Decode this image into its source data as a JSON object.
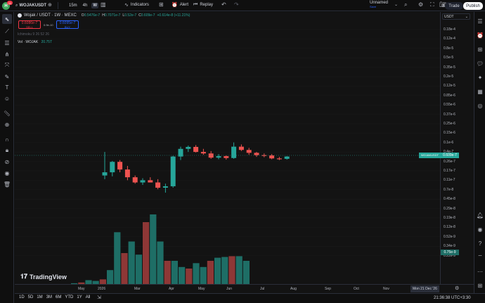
{
  "topbar": {
    "avatar_letter": "H",
    "notif_count": "11",
    "symbol": "WOJAKUSDT",
    "intervals": [
      "15m",
      "4h",
      "W"
    ],
    "active_interval": "W",
    "indicators_label": "Indicators",
    "alert_label": "Alert",
    "replay_label": "Replay",
    "layout_name": "Unnamed",
    "layout_status": "Save",
    "trade_label": "Trade",
    "publish_label": "Publish"
  },
  "legend": {
    "title": "Wojak / USDT · 1W · MEXC",
    "o_label": "O",
    "o_value": "0.5476e-7",
    "h_label": "H",
    "h_value": "0.7071e-7",
    "l_label": "L",
    "l_value": "0.52e-7",
    "c_label": "C",
    "c_value": "0.609e-7",
    "change": "+0.614e-8 (+11.21%)",
    "sell_price": "0.6086e-7",
    "sell_label": "SELL",
    "spread": "0.9e-10",
    "buy_price": "0.6095e-7",
    "buy_label": "BUY",
    "ichimoku": "Ichimoku 9 26 52 26",
    "vol_label": "Vol · WOJAK",
    "vol_value": "20.75T"
  },
  "price_axis": {
    "currency": "USDT",
    "labels": [
      "0.18e-4",
      "0.12e-4",
      "0.8e-5",
      "0.5e-5",
      "0.35e-5",
      "0.2e-5",
      "0.12e-5",
      "0.85e-6",
      "0.55e-6",
      "0.37e-6",
      "0.25e-6",
      "0.15e-6",
      "0.1e-6",
      "0.4e-7",
      "0.26e-7",
      "0.17e-7",
      "0.11e-7",
      "0.7e-8",
      "0.45e-8",
      "0.29e-8",
      "0.19e-8",
      "0.12e-8",
      "0.52e-9",
      "0.34e-9",
      "0.22e-9"
    ],
    "symbol_tag": "WOJAKUSDT",
    "last_price": "0.609e-7",
    "vol_tag": "0.75e-9"
  },
  "time_axis": {
    "labels": [
      "May",
      "2026",
      "Mar",
      "Apr",
      "May",
      "Jun",
      "Jul",
      "Aug",
      "Sep",
      "Oct",
      "Nov"
    ],
    "crosshair_date": "Mon 21 Dec '26"
  },
  "bottombar": {
    "ranges": [
      "1D",
      "5D",
      "1M",
      "3M",
      "6M",
      "YTD",
      "1Y",
      "All"
    ],
    "clock": "21:36:38 UTC+3:30"
  },
  "watermark": "TradingView",
  "colors": {
    "up": "#26a69a",
    "down": "#ef5350",
    "vol_up": "#1e6e66",
    "vol_down": "#8e3736",
    "bg": "#131313"
  },
  "chart_data": {
    "type": "candlestick",
    "candles": [
      {
        "o": 0.26,
        "h": 0.75,
        "l": 0.22,
        "c": 0.3
      },
      {
        "o": 0.3,
        "h": 0.5,
        "l": 0.25,
        "c": 0.48
      },
      {
        "o": 0.48,
        "h": 0.52,
        "l": 0.3,
        "c": 0.34
      },
      {
        "o": 0.34,
        "h": 0.4,
        "l": 0.21,
        "c": 0.24
      },
      {
        "o": 0.24,
        "h": 0.26,
        "l": 0.18,
        "c": 0.19
      },
      {
        "o": 0.19,
        "h": 0.23,
        "l": 0.17,
        "c": 0.21
      },
      {
        "o": 0.21,
        "h": 0.24,
        "l": 0.19,
        "c": 0.19
      },
      {
        "o": 0.19,
        "h": 0.22,
        "l": 0.14,
        "c": 0.15
      },
      {
        "o": 0.15,
        "h": 0.18,
        "l": 0.12,
        "c": 0.16
      },
      {
        "o": 0.16,
        "h": 0.63,
        "l": 0.15,
        "c": 0.61
      },
      {
        "o": 0.61,
        "h": 0.95,
        "l": 0.52,
        "c": 0.86
      },
      {
        "o": 0.86,
        "h": 1.0,
        "l": 0.75,
        "c": 0.94
      },
      {
        "o": 0.94,
        "h": 1.02,
        "l": 0.73,
        "c": 0.75
      },
      {
        "o": 0.75,
        "h": 0.86,
        "l": 0.66,
        "c": 0.7
      },
      {
        "o": 0.7,
        "h": 0.78,
        "l": 0.55,
        "c": 0.58
      },
      {
        "o": 0.58,
        "h": 0.68,
        "l": 0.54,
        "c": 0.62
      },
      {
        "o": 0.62,
        "h": 0.64,
        "l": 0.53,
        "c": 0.57
      },
      {
        "o": 0.57,
        "h": 1.15,
        "l": 0.55,
        "c": 0.95
      },
      {
        "o": 0.95,
        "h": 1.05,
        "l": 0.78,
        "c": 0.82
      },
      {
        "o": 0.82,
        "h": 0.9,
        "l": 0.66,
        "c": 0.72
      },
      {
        "o": 0.72,
        "h": 0.75,
        "l": 0.6,
        "c": 0.65
      },
      {
        "o": 0.65,
        "h": 0.7,
        "l": 0.59,
        "c": 0.64
      },
      {
        "o": 0.64,
        "h": 0.68,
        "l": 0.54,
        "c": 0.56
      },
      {
        "o": 0.56,
        "h": 0.6,
        "l": 0.52,
        "c": 0.55
      },
      {
        "o": 0.55,
        "h": 0.62,
        "l": 0.53,
        "c": 0.61
      }
    ],
    "volumes": [
      0.01,
      0.02,
      0.05,
      0.04,
      0.06,
      0.18,
      0.67,
      0.4,
      0.55,
      0.38,
      0.8,
      0.9,
      0.55,
      0.3,
      0.3,
      0.22,
      0.2,
      0.27,
      0.22,
      0.3,
      0.34,
      0.35,
      0.36,
      0.36,
      0.3
    ]
  }
}
